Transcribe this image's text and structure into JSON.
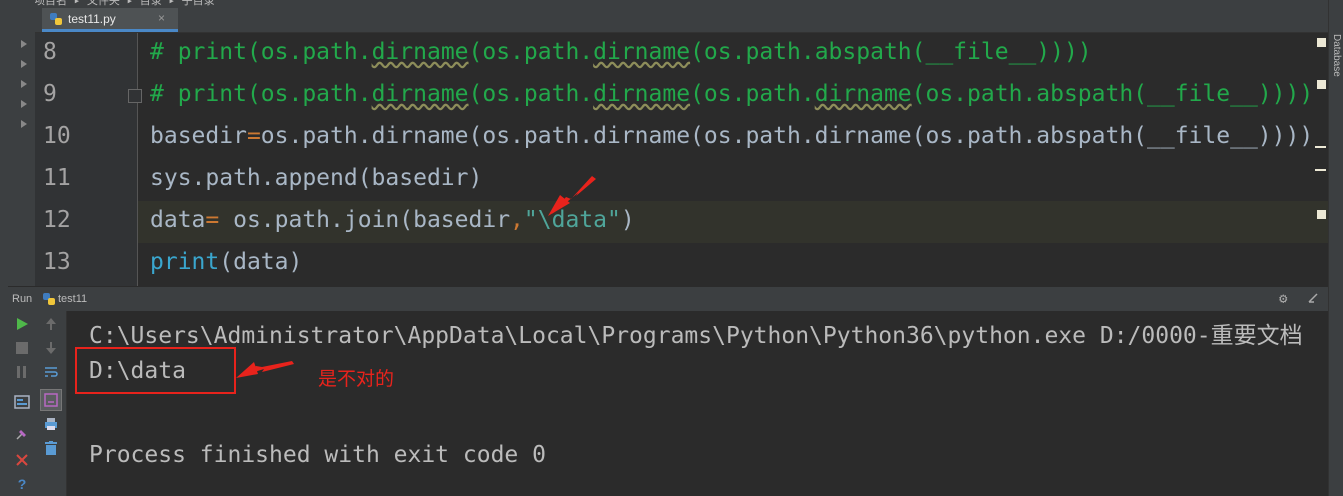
{
  "breadcrumb": {
    "text": "项目名 ▸ 文件夹 ▸ 目录 ▸ 子目录"
  },
  "editor_tab": {
    "label": "test11.py",
    "close": "×"
  },
  "right_panel": {
    "label": "Database"
  },
  "editor": {
    "lines": [
      {
        "number": "8"
      },
      {
        "number": "9"
      },
      {
        "number": "10"
      },
      {
        "number": "11"
      },
      {
        "number": "12"
      },
      {
        "number": "13"
      }
    ],
    "code": {
      "l8": {
        "hash": "# ",
        "p1": "print(os.path.",
        "w1": "dirname",
        "p2": "(os.path.",
        "w2": "dirname",
        "p3": "(os.path.abspath(__file__))))"
      },
      "l9": {
        "hash": "# ",
        "p1": "print(os.path.",
        "w1": "dirname",
        "p2": "(os.path.",
        "w2": "dirname",
        "p3": "(os.path.",
        "w3": "dirname",
        "p4": "(os.path.abspath(__file__))))"
      },
      "l10": {
        "a": "basedir",
        "eq": "=",
        "b": "os.path.dirname(os.path.dirname(os.path.dirname(os.path.abspath(__file__))))"
      },
      "l11": {
        "a": "sys.path.append(basedir)"
      },
      "l12": {
        "a": "data",
        "eq": "=",
        "b": " os.path.join(basedir",
        "comma": ",",
        "s": "\"\\data\"",
        "c": ")"
      },
      "l13": {
        "fn": "print",
        "a": "(data)"
      }
    }
  },
  "run_panel": {
    "title": "Run",
    "config_name": "test11",
    "output": [
      "C:\\Users\\Administrator\\AppData\\Local\\Programs\\Python\\Python36\\python.exe D:/0000-重要文档",
      "D:\\data",
      "",
      "Process finished with exit code 0"
    ]
  },
  "annotation": {
    "text": "是不对的",
    "color": "#e8231c"
  },
  "colors": {
    "accent": "#4a88c7",
    "comment": "#22a94b",
    "keyword_op": "#cc7832",
    "builtin": "#3aa6ce",
    "annotation": "#e8231c"
  }
}
